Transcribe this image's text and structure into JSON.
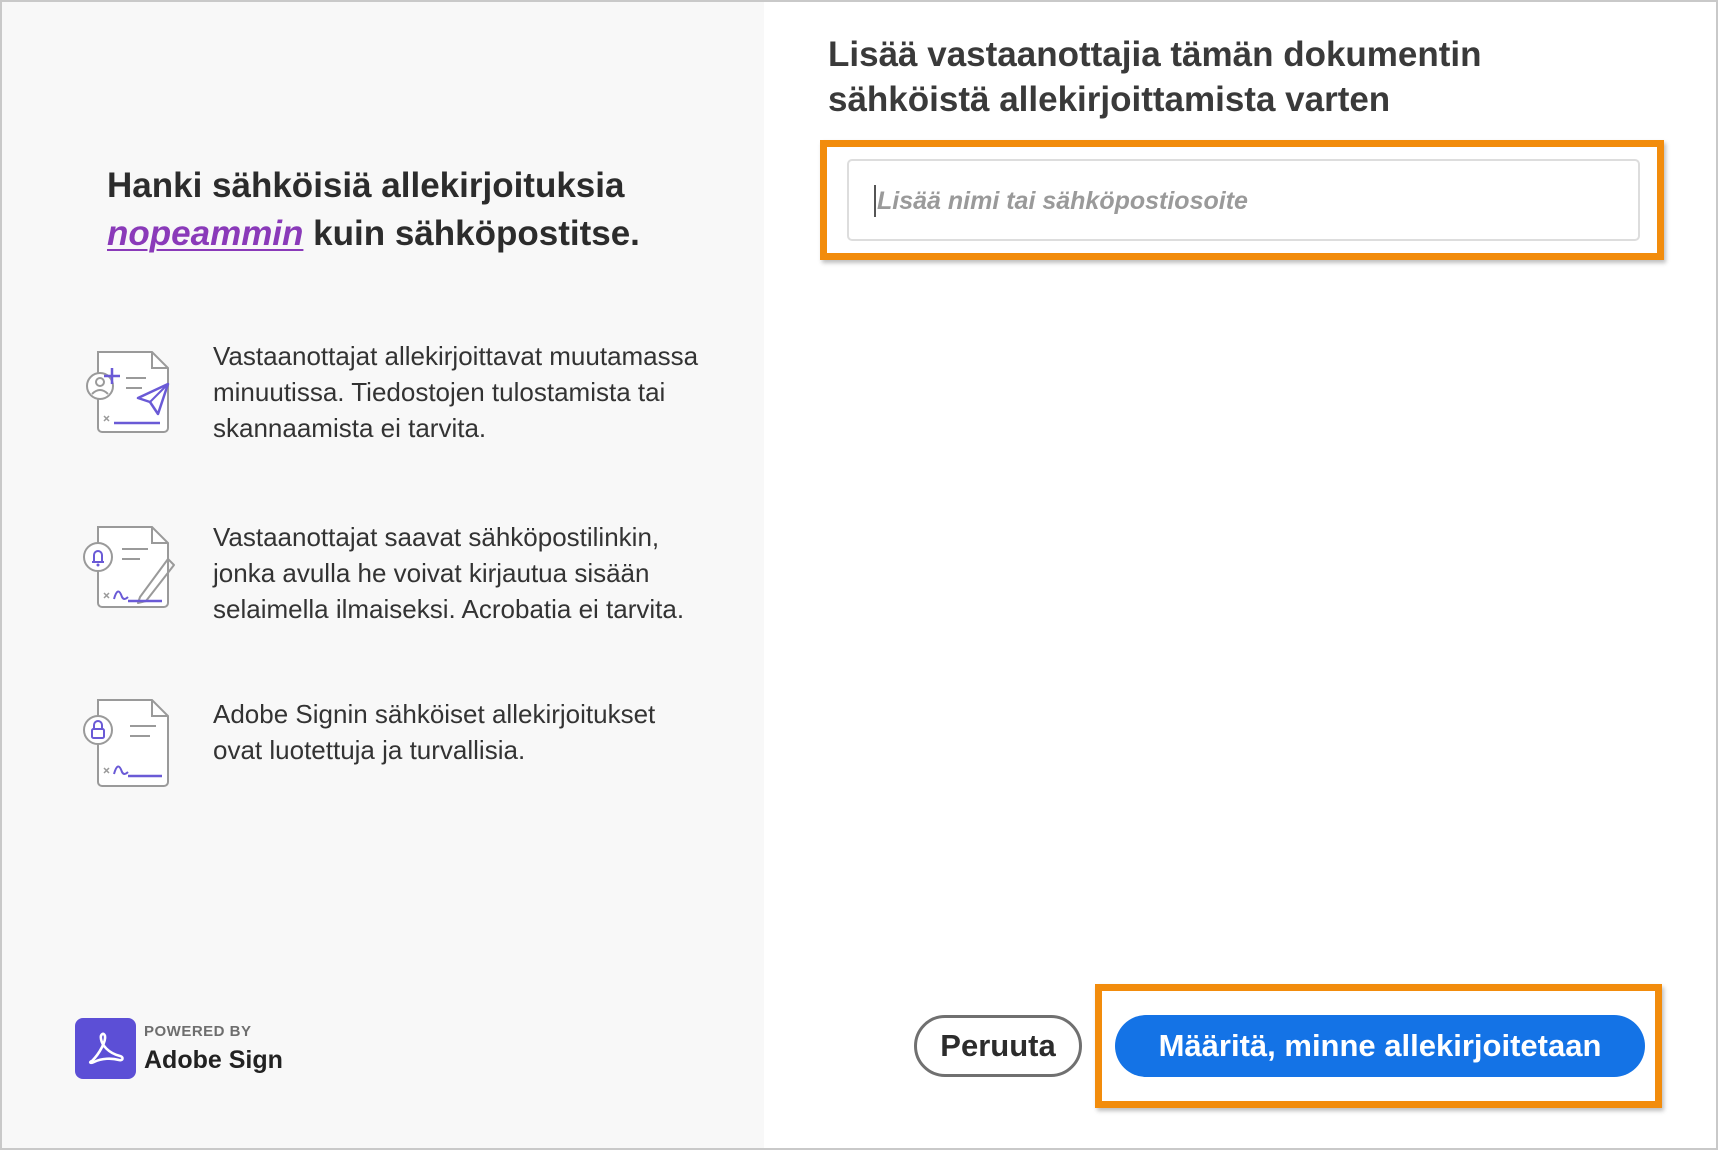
{
  "left": {
    "headline_line1": "Hanki sähköisiä allekirjoituksia",
    "headline_accent": "nopeammin",
    "headline_rest": " kuin sähköpostitse.",
    "features": [
      {
        "icon": "send-document-icon",
        "text": "Vastaanottajat allekirjoittavat muutamassa minuutissa. Tiedostojen tulostamista tai skannaamista ei tarvita."
      },
      {
        "icon": "notification-sign-icon",
        "text": "Vastaanottajat saavat sähköpostilinkin, jonka avulla he voivat kirjautua sisään selaimella ilmaiseksi. Acrobatia ei tarvita."
      },
      {
        "icon": "secure-document-icon",
        "text": "Adobe Signin sähköiset allekirjoitukset ovat luotettuja ja turvallisia."
      }
    ],
    "powered_by": "POWERED BY",
    "brand": "Adobe Sign"
  },
  "right": {
    "title": "Lisää vastaanottajia tämän dokumentin sähköistä allekirjoittamista varten",
    "recipient_placeholder": "Lisää nimi tai sähköpostiosoite",
    "cancel_label": "Peruuta",
    "primary_label": "Määritä, minne allekirjoitetaan"
  },
  "colors": {
    "accent_purple": "#8a3ab9",
    "primary_blue": "#1473e6",
    "highlight_orange": "#f28c0c",
    "adobe_logo": "#5c4fd6"
  }
}
